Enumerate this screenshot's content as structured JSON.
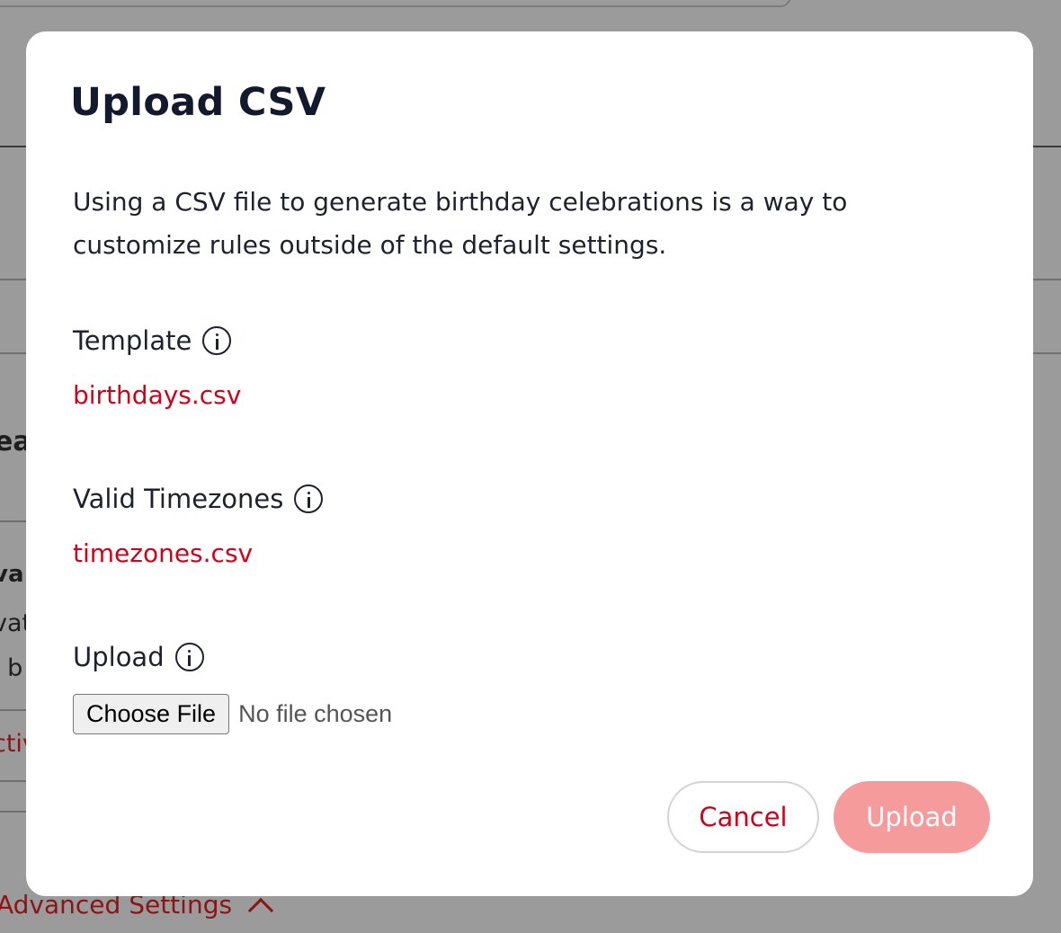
{
  "background": {
    "fragment_heading": "ea",
    "fragment_bold": "va",
    "fragment_line1": "vat",
    "fragment_line2": "l b",
    "fragment_link": "ctiv",
    "advanced_settings": "Advanced Settings"
  },
  "modal": {
    "title": "Upload CSV",
    "description": "Using a CSV file to generate birthday celebrations is a way to customize rules outside of the default settings.",
    "template": {
      "label": "Template",
      "file": "birthdays.csv"
    },
    "timezones": {
      "label": "Valid Timezones",
      "file": "timezones.csv"
    },
    "upload": {
      "label": "Upload",
      "choose_button": "Choose File",
      "status": "No file chosen"
    },
    "buttons": {
      "cancel": "Cancel",
      "upload": "Upload"
    }
  },
  "colors": {
    "accent": "#d0021b",
    "upload_disabled": "#f59b9b",
    "overlay": "#9b9b9b",
    "title": "#141a2e"
  },
  "icons": [
    "info-icon",
    "chevron-up-icon"
  ]
}
